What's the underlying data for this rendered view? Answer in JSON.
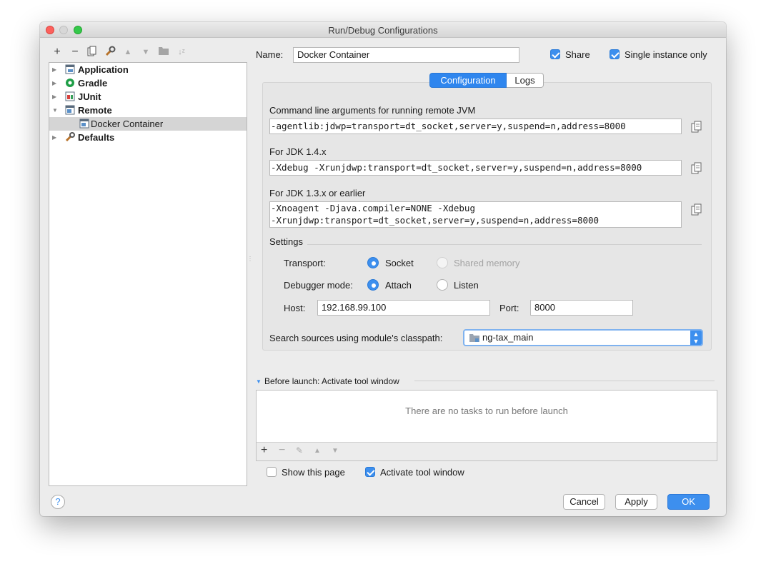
{
  "window": {
    "title": "Run/Debug Configurations"
  },
  "toolbar": [
    "add-icon",
    "remove-icon",
    "copy-icon",
    "wrench-icon",
    "move-up-icon",
    "move-down-icon",
    "folder-icon",
    "sort-icon"
  ],
  "tree": {
    "items": [
      {
        "label": "Application"
      },
      {
        "label": "Gradle"
      },
      {
        "label": "JUnit"
      },
      {
        "label": "Remote"
      },
      {
        "label": "Docker Container"
      },
      {
        "label": "Defaults"
      }
    ]
  },
  "config": {
    "name_label": "Name:",
    "name_value": "Docker Container",
    "share_label": "Share",
    "single_instance_label": "Single instance only",
    "tabs": [
      {
        "label": "Configuration"
      },
      {
        "label": "Logs"
      }
    ],
    "cmd_label": "Command line arguments for running remote JVM",
    "cmd_value": "-agentlib:jdwp=transport=dt_socket,server=y,suspend=n,address=8000",
    "jdk14_label": "For JDK 1.4.x",
    "jdk14_value": "-Xdebug -Xrunjdwp:transport=dt_socket,server=y,suspend=n,address=8000",
    "jdk13_label": "For JDK 1.3.x or earlier",
    "jdk13_line1": "-Xnoagent -Djava.compiler=NONE -Xdebug",
    "jdk13_line2": "-Xrunjdwp:transport=dt_socket,server=y,suspend=n,address=8000",
    "settings_label": "Settings",
    "transport_label": "Transport:",
    "transport_socket": "Socket",
    "transport_shared": "Shared memory",
    "debugger_mode_label": "Debugger mode:",
    "mode_attach": "Attach",
    "mode_listen": "Listen",
    "host_label": "Host:",
    "host_value": "192.168.99.100",
    "port_label": "Port:",
    "port_value": "8000",
    "classpath_label": "Search sources using module's classpath:",
    "classpath_value": "ng-tax_main"
  },
  "before_launch": {
    "title": "Before launch: Activate tool window",
    "empty_text": "There are no tasks to run before launch",
    "show_page_label": "Show this page",
    "activate_label": "Activate tool window"
  },
  "footer": {
    "help": "?",
    "cancel": "Cancel",
    "apply": "Apply",
    "ok": "OK"
  },
  "colors": {
    "accent": "#3d8fee",
    "selection": "#d5d5d5"
  }
}
